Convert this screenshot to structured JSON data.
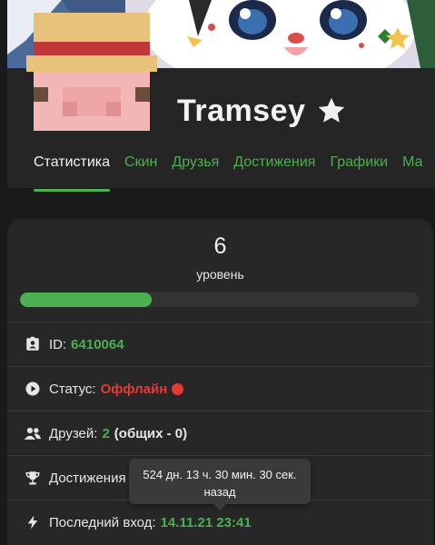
{
  "profile": {
    "username": "Tramsey"
  },
  "tabs": [
    {
      "label": "Статистика"
    },
    {
      "label": "Скин"
    },
    {
      "label": "Друзья"
    },
    {
      "label": "Достижения"
    },
    {
      "label": "Графики"
    },
    {
      "label": "Ма"
    }
  ],
  "stats": {
    "level_value": "6",
    "level_label": "уровень",
    "level_progress_percent": 33,
    "id_label": "ID:",
    "id_value": "6410064",
    "status_label": "Статус:",
    "status_value": "Оффлайн",
    "friends_label": "Друзей:",
    "friends_count": "2",
    "friends_common": "(общих - 0)",
    "achievements_label": "Достижения",
    "last_login_label": "Последний вход:",
    "last_login_value": "14.11.21 23:41"
  },
  "tooltip": {
    "line1": "524 дн. 13 ч. 30 мин. 30 сек.",
    "line2": "назад"
  },
  "colors": {
    "accent_green": "#4caf50",
    "offline_red": "#e53935",
    "background": "#1a1a1a",
    "card": "#272727"
  },
  "icons": {
    "verified": "star-icon",
    "id": "id-badge-icon",
    "status": "play-circle-icon",
    "friends": "users-icon",
    "achievements": "trophy-icon",
    "last_login": "lightning-icon"
  }
}
